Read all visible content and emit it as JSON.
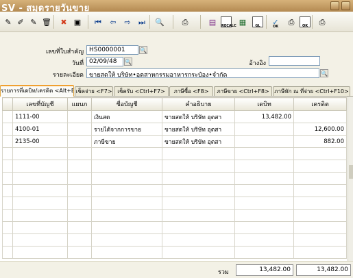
{
  "window": {
    "title": "SV - สมุดรายวันขาย"
  },
  "toolbar": {
    "buttons": [
      {
        "icon": "edit-doc-icon",
        "glyph": "✎"
      },
      {
        "icon": "edit-pencil-icon",
        "glyph": "✐"
      },
      {
        "icon": "edit-doc2-icon",
        "glyph": "✎"
      },
      {
        "icon": "trash-icon",
        "glyph": "🗑"
      },
      {
        "icon": "cancel-icon",
        "glyph": "✖"
      },
      {
        "icon": "save-icon",
        "glyph": "▣"
      },
      {
        "icon": "first-record-icon",
        "glyph": "⏮"
      },
      {
        "icon": "prev-record-icon",
        "glyph": "⇦"
      },
      {
        "icon": "next-record-icon",
        "glyph": "⇨"
      },
      {
        "icon": "last-record-icon",
        "glyph": "⏭"
      },
      {
        "icon": "search-icon",
        "glyph": "🔍"
      },
      {
        "icon": "print-icon",
        "glyph": "⎙"
      },
      {
        "icon": "film-icon",
        "glyph": "▤"
      },
      {
        "icon": "recalc-icon",
        "glyph": "",
        "label": "RECALC"
      },
      {
        "icon": "ledger-icon",
        "glyph": "▦"
      },
      {
        "icon": "gl-icon",
        "glyph": "",
        "label": "GL"
      },
      {
        "icon": "approve-ok-icon",
        "glyph": "✓",
        "label": "OK"
      },
      {
        "icon": "print-preview-icon",
        "glyph": "⎙"
      },
      {
        "icon": "ok-icon",
        "glyph": "",
        "label": "OK"
      },
      {
        "icon": "printer-dropdown-icon",
        "glyph": "⎙"
      }
    ]
  },
  "form": {
    "doc_no_label": "เลขที่ใบสำคัญ",
    "doc_no_value": "HS0000001",
    "date_label": "วันที่",
    "date_value": "02/09/48",
    "ref_label": "อ้างอิง",
    "ref_value": "",
    "detail_label": "รายละเอียด",
    "detail_value": "ขายสดให้      บริษัท•อุตสาหกรรมอาหารกระป๋อง•จำกัด"
  },
  "tabs": [
    {
      "label": "รายการที่เดบิท/เครดิต <Alt+E>",
      "active": true
    },
    {
      "label": "เช็คจ่าย <F7>",
      "active": false
    },
    {
      "label": "เช็ครับ <Ctrl+F7>",
      "active": false
    },
    {
      "label": "ภาษีซื้อ <F8>",
      "active": false
    },
    {
      "label": "ภาษีขาย <Ctrl+F8>",
      "active": false
    },
    {
      "label": "ภาษีหัก ณ ที่จ่าย <Ctrl+F10>",
      "active": false
    }
  ],
  "grid": {
    "columns": [
      "เลขที่บัญชี",
      "แผนก",
      "ชื่อบัญชี",
      "คำอธิบาย",
      "เดบิท",
      "เครดิต"
    ],
    "rows": [
      [
        "1111-00",
        "",
        "เงินสด",
        "ขายสดให้     บริษัท อุตสา",
        "13,482.00",
        ""
      ],
      [
        "4100-01",
        "",
        "รายได้จากการขาย",
        "ขายสดให้     บริษัท อุตสา",
        "",
        "12,600.00"
      ],
      [
        "2135-00",
        "",
        "ภาษีขาย",
        "ขายสดให้     บริษัท อุตสา",
        "",
        "882.00"
      ],
      [
        "",
        "",
        "",
        "",
        "",
        ""
      ],
      [
        "",
        "",
        "",
        "",
        "",
        ""
      ],
      [
        "",
        "",
        "",
        "",
        "",
        ""
      ],
      [
        "",
        "",
        "",
        "",
        "",
        ""
      ],
      [
        "",
        "",
        "",
        "",
        "",
        ""
      ],
      [
        "",
        "",
        "",
        "",
        "",
        ""
      ],
      [
        "",
        "",
        "",
        "",
        "",
        ""
      ],
      [
        "",
        "",
        "",
        "",
        "",
        ""
      ],
      [
        "",
        "",
        "",
        "",
        "",
        ""
      ]
    ]
  },
  "totals": {
    "label": "รวม",
    "debit": "13,482.00",
    "credit": "13,482.00"
  }
}
